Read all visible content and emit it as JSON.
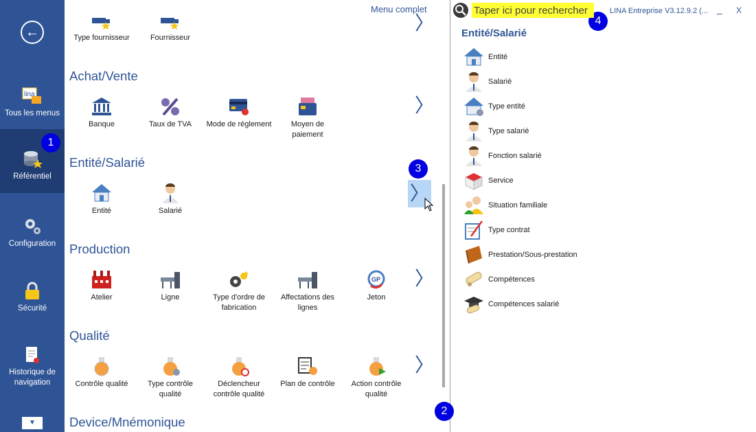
{
  "nav": {
    "items": [
      {
        "label": "Tous les menus"
      },
      {
        "label": "Référentiel"
      },
      {
        "label": "Configuration"
      },
      {
        "label": "Sécurité"
      },
      {
        "label": "Historique de navigation"
      }
    ],
    "active_color": "#1f3c73",
    "bg_color": "#2f5496",
    "logo_text": "lina"
  },
  "header": {
    "menu_complet": "Menu complet",
    "search_placeholder": "Taper ici pour rechercher",
    "app_title": "LINA Entreprise  V3.12.9.2  (...",
    "minimize": "_",
    "close": "X"
  },
  "sections": {
    "top_row": [
      {
        "label": "Type fournisseur"
      },
      {
        "label": "Fournisseur"
      }
    ],
    "achat_vente": {
      "title": "Achat/Vente",
      "items": [
        {
          "label": "Banque"
        },
        {
          "label": "Taux de TVA"
        },
        {
          "label": "Mode de réglement"
        },
        {
          "label": "Moyen de paiement"
        }
      ]
    },
    "entite_salarie": {
      "title": "Entité/Salarié",
      "items": [
        {
          "label": "Entité"
        },
        {
          "label": "Salarié"
        }
      ]
    },
    "production": {
      "title": "Production",
      "items": [
        {
          "label": "Atelier"
        },
        {
          "label": "Ligne"
        },
        {
          "label": "Type d'ordre de fabrication"
        },
        {
          "label": "Affectations des lignes"
        },
        {
          "label": "Jeton"
        }
      ]
    },
    "qualite": {
      "title": "Qualité",
      "items": [
        {
          "label": "Contrôle qualité"
        },
        {
          "label": "Type contrôle qualité"
        },
        {
          "label": "Déclencheur contrôle qualité"
        },
        {
          "label": "Plan de contrôle"
        },
        {
          "label": "Action contrôle qualité"
        }
      ]
    },
    "device": {
      "title": "Device/Mnémonique"
    }
  },
  "badges": [
    "1",
    "2",
    "3",
    "4"
  ],
  "right_panel": {
    "title": "Entité/Salarié",
    "items": [
      {
        "label": "Entité",
        "icon": "house-icon"
      },
      {
        "label": "Salarié",
        "icon": "person-icon"
      },
      {
        "label": "Type entité",
        "icon": "house-gear-icon"
      },
      {
        "label": "Type salarié",
        "icon": "person-icon"
      },
      {
        "label": "Fonction salarié",
        "icon": "person-icon"
      },
      {
        "label": "Service",
        "icon": "gift-box-icon"
      },
      {
        "label": "Situation familiale",
        "icon": "family-icon"
      },
      {
        "label": "Type contrat",
        "icon": "contract-icon"
      },
      {
        "label": "Prestation/Sous-prestation",
        "icon": "book-icon"
      },
      {
        "label": "Compétences",
        "icon": "diploma-icon"
      },
      {
        "label": "Compétences salarié",
        "icon": "graduation-icon"
      }
    ]
  },
  "colors": {
    "accent": "#2f5496",
    "search_highlight": "#ffff33",
    "badge": "#0000e0",
    "chevron_highlight": "#b8d6f5"
  }
}
